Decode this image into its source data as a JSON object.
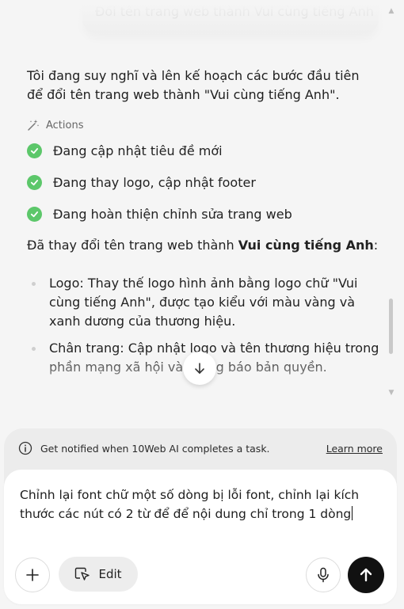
{
  "chat": {
    "user_message": "Đổi tên trang web thành Vui cùng tiếng Anh",
    "intro": "Tôi đang suy nghĩ và lên kế hoạch các bước đầu tiên để đổi tên trang web thành \"Vui cùng tiếng Anh\".",
    "actions_label": "Actions",
    "actions": [
      {
        "label": "Đang cập nhật tiêu đề mới"
      },
      {
        "label": "Đang thay logo, cập nhật footer"
      },
      {
        "label": "Đang hoàn thiện chỉnh sửa trang web"
      }
    ],
    "summary_prefix": "Đã thay đổi tên trang web thành ",
    "summary_bold": "Vui cùng tiếng Anh",
    "summary_suffix": ":",
    "bullets": [
      "Logo: Thay thế logo hình ảnh bằng logo chữ \"Vui cùng tiếng Anh\", được tạo kiểu với màu vàng và xanh dương của thương hiệu.",
      "Chân trang: Cập nhật logo và tên thương hiệu trong phần mạng xã hội và thông báo bản quyền."
    ]
  },
  "notice": {
    "text": "Get notified when 10Web AI completes a task.",
    "link": "Learn more"
  },
  "composer": {
    "text": "Chỉnh lại font chữ một số dòng bị lỗi font, chỉnh lại kích thước các nút có 2 từ để để nội dung chỉ trong 1 dòng",
    "edit_label": "Edit"
  },
  "colors": {
    "check_green": "#5cc76a",
    "send_button": "#111111"
  }
}
